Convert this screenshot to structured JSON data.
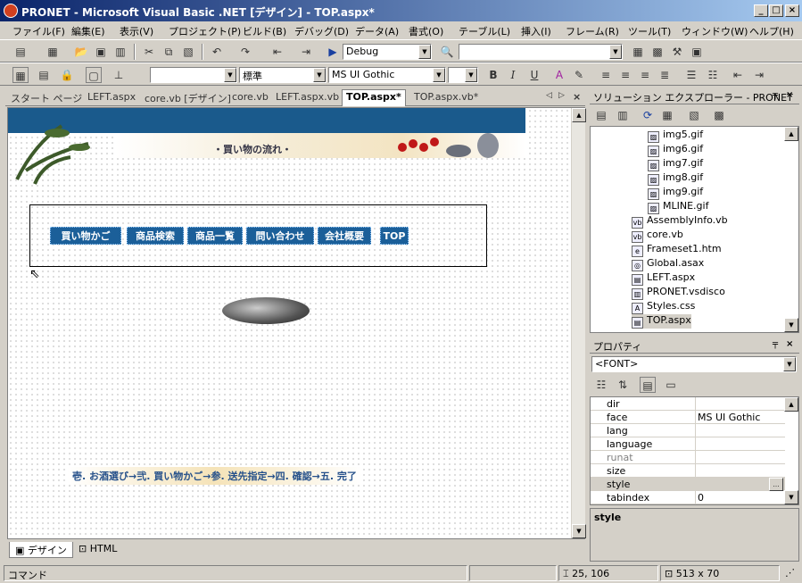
{
  "window": {
    "title": "PRONET - Microsoft Visual Basic .NET [デザイン] - TOP.aspx*"
  },
  "menu": [
    "ファイル(F)",
    "編集(E)",
    "表示(V)",
    "プロジェクト(P)",
    "ビルド(B)",
    "デバッグ(D)",
    "データ(A)",
    "書式(O)",
    "テーブル(L)",
    "挿入(I)",
    "フレーム(R)",
    "ツール(T)",
    "ウィンドウ(W)",
    "ヘルプ(H)"
  ],
  "toolbar": {
    "config": "Debug",
    "find": "",
    "style": "",
    "block_format": "標準",
    "font": "MS UI Gothic",
    "font_size": ""
  },
  "tabs": [
    "スタート ページ",
    "LEFT.aspx",
    "core.vb [デザイン]",
    "core.vb",
    "LEFT.aspx.vb",
    "TOP.aspx*",
    "TOP.aspx.vb*"
  ],
  "design": {
    "banner_title": "・買い物の流れ・",
    "nav_buttons": [
      "買い物かご",
      "商品検索",
      "商品一覧",
      "問い合わせ",
      "会社概要",
      "TOP"
    ],
    "flow_text": "壱. お酒選び→弐. 買い物かご→参. 送先指定→四. 確認→五. 完了"
  },
  "view_tabs": [
    "デザイン",
    "HTML"
  ],
  "solution": {
    "title": "ソリューション エクスプローラー - PRONET",
    "items": [
      {
        "name": "img5.gif",
        "icon": "image-icon"
      },
      {
        "name": "img6.gif",
        "icon": "image-icon"
      },
      {
        "name": "img7.gif",
        "icon": "image-icon"
      },
      {
        "name": "img8.gif",
        "icon": "image-icon"
      },
      {
        "name": "img9.gif",
        "icon": "image-icon"
      },
      {
        "name": "MLINE.gif",
        "icon": "image-icon"
      },
      {
        "name": "AssemblyInfo.vb",
        "icon": "vb-file-icon"
      },
      {
        "name": "core.vb",
        "icon": "vb-file-icon"
      },
      {
        "name": "Frameset1.htm",
        "icon": "html-file-icon"
      },
      {
        "name": "Global.asax",
        "icon": "global-icon"
      },
      {
        "name": "LEFT.aspx",
        "icon": "aspx-file-icon"
      },
      {
        "name": "PRONET.vsdisco",
        "icon": "disco-file-icon"
      },
      {
        "name": "Styles.css",
        "icon": "css-file-icon"
      },
      {
        "name": "TOP.aspx",
        "icon": "aspx-file-icon"
      }
    ]
  },
  "properties": {
    "title": "プロパティ",
    "object": "<FONT>",
    "rows": [
      {
        "key": "dir",
        "value": ""
      },
      {
        "key": "face",
        "value": "MS UI Gothic"
      },
      {
        "key": "lang",
        "value": ""
      },
      {
        "key": "language",
        "value": ""
      },
      {
        "key": "runat",
        "value": ""
      },
      {
        "key": "size",
        "value": ""
      },
      {
        "key": "style",
        "value": ""
      },
      {
        "key": "tabindex",
        "value": "0"
      }
    ],
    "description": "style"
  },
  "status": {
    "left": "コマンド",
    "position": "25, 106",
    "size": "513 x 70"
  }
}
